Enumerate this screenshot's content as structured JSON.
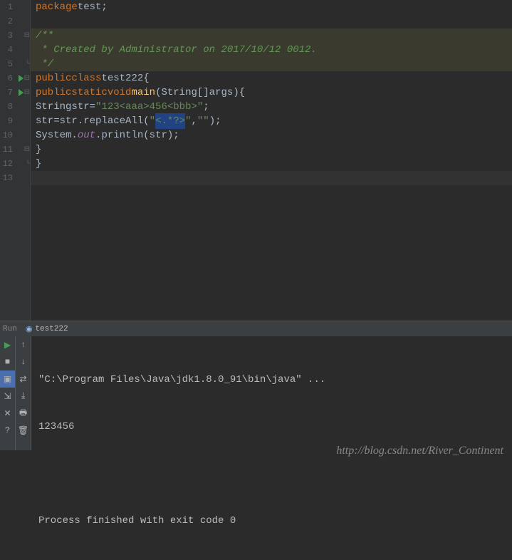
{
  "gutter": {
    "lines": [
      "1",
      "2",
      "3",
      "4",
      "5",
      "6",
      "7",
      "8",
      "9",
      "10",
      "11",
      "12",
      "13"
    ]
  },
  "code": {
    "l1": {
      "kw_package": "package",
      "pkg": "test",
      "semi": ";"
    },
    "l3": {
      "doc": "/**"
    },
    "l4": {
      "doc": " * Created by Administrator on 2017/10/12 0012."
    },
    "l5": {
      "doc": " */"
    },
    "l6": {
      "kw_public": "public",
      "kw_class": "class",
      "name": "test222",
      "brace": "{"
    },
    "l7": {
      "kw_public": "public",
      "kw_static": "static",
      "kw_void": "void",
      "main": "main",
      "paren_open": "(",
      "string_type": "String",
      "brackets": "[]",
      "args": "args",
      "paren_close": ")",
      "brace": "{"
    },
    "l8": {
      "string_type": "String",
      "var": "str",
      "eq": "=",
      "lit": "\"123<aaa>456<bbb>\"",
      "semi": ";"
    },
    "l9": {
      "var": "str",
      "eq": "=",
      "var2": "str",
      "dot": ".",
      "method": "replaceAll",
      "paren_open": "(",
      "lit1": "\"",
      "sel": "<.*?>",
      "lit1b": "\"",
      "comma": ",",
      "lit2": "\"\"",
      "paren_close": ")",
      "semi": ";"
    },
    "l10": {
      "sys": "System",
      "dot1": ".",
      "out": "out",
      "dot2": ".",
      "println": "println",
      "paren_open": "(",
      "var": "str",
      "paren_close": ")",
      "semi": ";"
    },
    "l11": {
      "brace": "}"
    },
    "l12": {
      "brace": "}"
    }
  },
  "runtab": {
    "label": "Run",
    "config": "test222"
  },
  "console": {
    "cmd": "\"C:\\Program Files\\Java\\jdk1.8.0_91\\bin\\java\" ...",
    "out": "123456",
    "exit": "Process finished with exit code 0"
  },
  "watermark": "http://blog.csdn.net/River_Continent"
}
